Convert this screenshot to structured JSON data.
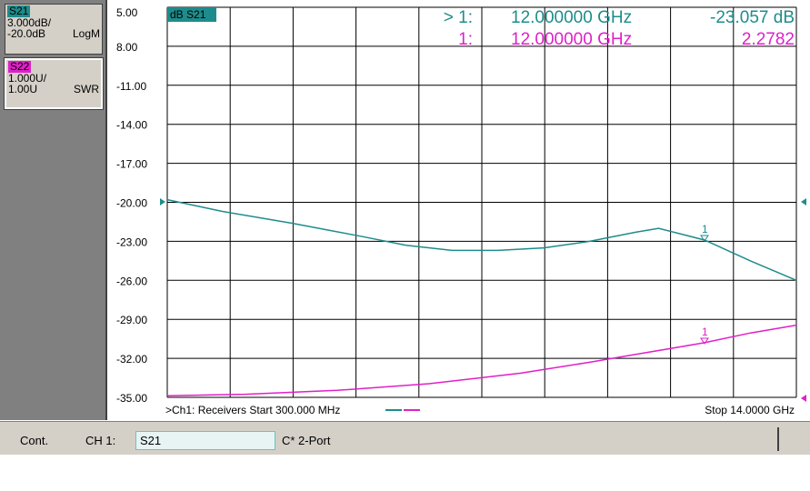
{
  "colors": {
    "s21": "#1e8c8c",
    "s22": "#e020c8",
    "grid": "#000000"
  },
  "traces": [
    {
      "name": "S21",
      "scale": "3.000dB/",
      "ref": "-20.0dB",
      "format": "LogM"
    },
    {
      "name": "S22",
      "scale": "1.000U/",
      "ref": "1.00U",
      "format": "SWR"
    }
  ],
  "plot": {
    "trace_label": "dB S21",
    "y_ticks": [
      "5.00",
      "8.00",
      "-11.00",
      "-14.00",
      "-17.00",
      "-20.00",
      "-23.00",
      "-26.00",
      "-29.00",
      "-32.00",
      "-35.00"
    ],
    "marker_readouts": [
      {
        "id": "> 1:",
        "freq": "12.000000 GHz",
        "value": "-23.057 dB",
        "color": "#1e8c8c"
      },
      {
        "id": "1:",
        "freq": "12.000000 GHz",
        "value": "2.2782",
        "color": "#e020c8"
      }
    ],
    "marker_label": "1",
    "footer_left": ">Ch1: Receivers Start  300.000 MHz",
    "footer_right": "Stop  14.0000 GHz"
  },
  "chart_data": {
    "type": "line",
    "x_start_ghz": 0.3,
    "x_stop_ghz": 14.0,
    "series": [
      {
        "name": "S21",
        "x": [
          0.3,
          1.5,
          3.0,
          4.5,
          5.5,
          6.5,
          7.5,
          8.5,
          9.5,
          10.5,
          11.0,
          12.0,
          13.0,
          14.0
        ],
        "y": [
          -19.8,
          -20.7,
          -21.6,
          -22.6,
          -23.3,
          -23.7,
          -23.7,
          -23.5,
          -23.0,
          -22.3,
          -22.0,
          -22.9,
          -24.5,
          -26.0
        ]
      },
      {
        "name": "S22",
        "x": [
          0.3,
          2.0,
          4.0,
          6.0,
          8.0,
          9.5,
          10.5,
          11.5,
          12.0,
          13.0,
          14.0
        ],
        "y": [
          1.04,
          1.08,
          1.18,
          1.35,
          1.62,
          1.9,
          2.1,
          2.3,
          2.4,
          2.65,
          2.85
        ]
      }
    ],
    "s21_scale_db_per_div": 3.0,
    "s22_scale_u_per_div": 1.0,
    "s22_ref_u": 1.0,
    "marker_x_ghz": 12.0
  },
  "status": {
    "mode": "Cont.",
    "channel": "CH 1:",
    "measurement": "S21",
    "cal": "C* 2-Port"
  }
}
